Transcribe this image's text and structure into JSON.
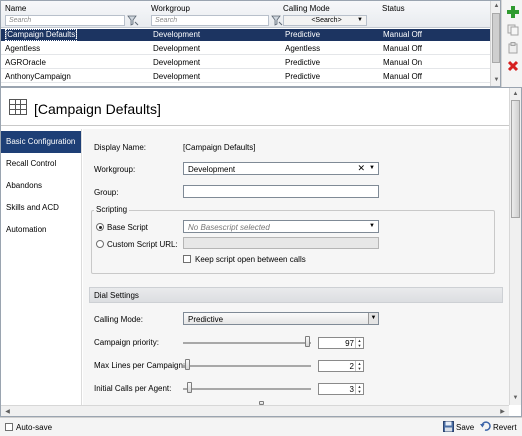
{
  "grid": {
    "columns": [
      {
        "label": "Name",
        "filter_placeholder": "Search"
      },
      {
        "label": "Workgroup",
        "filter_placeholder": "Search"
      },
      {
        "label": "Calling Mode",
        "filter_value": "<Search>"
      },
      {
        "label": "Status"
      }
    ],
    "rows": [
      {
        "name": "[Campaign Defaults]",
        "workgroup": "Development",
        "calling_mode": "Predictive",
        "status": "Manual Off"
      },
      {
        "name": "Agentless",
        "workgroup": "Development",
        "calling_mode": "Agentless",
        "status": "Manual Off"
      },
      {
        "name": "AGROracle",
        "workgroup": "Development",
        "calling_mode": "Predictive",
        "status": "Manual On"
      },
      {
        "name": "AnthonyCampaign",
        "workgroup": "Development",
        "calling_mode": "Predictive",
        "status": "Manual Off"
      }
    ]
  },
  "actions": {
    "add_icon": "plus-icon",
    "copy_icon": "copy-icon",
    "paste_icon": "paste-icon",
    "delete_icon": "delete-x-icon"
  },
  "detail": {
    "title": "[Campaign Defaults]",
    "nav": [
      "Basic Configuration",
      "Recall Control",
      "Abandons",
      "Skills and ACD",
      "Automation"
    ],
    "form": {
      "display_name_label": "Display Name:",
      "display_name_value": "[Campaign Defaults]",
      "workgroup_label": "Workgroup:",
      "workgroup_value": "Development",
      "group_label": "Group:",
      "group_value": "",
      "scripting_title": "Scripting",
      "base_script_label": "Base Script",
      "base_script_value": "No Basescript selected",
      "custom_script_label": "Custom Script URL:",
      "keep_script_label": "Keep script open between calls",
      "dial_settings_title": "Dial Settings",
      "calling_mode_label": "Calling Mode:",
      "calling_mode_value": "Predictive",
      "campaign_priority_label": "Campaign priority:",
      "campaign_priority_value": "97",
      "max_lines_label": "Max Lines per Campaign:",
      "max_lines_value": "2",
      "initial_calls_label": "Initial Calls per Agent:",
      "initial_calls_value": "3"
    }
  },
  "footer": {
    "autosave_label": "Auto-save",
    "save_label": "Save",
    "revert_label": "Revert"
  }
}
